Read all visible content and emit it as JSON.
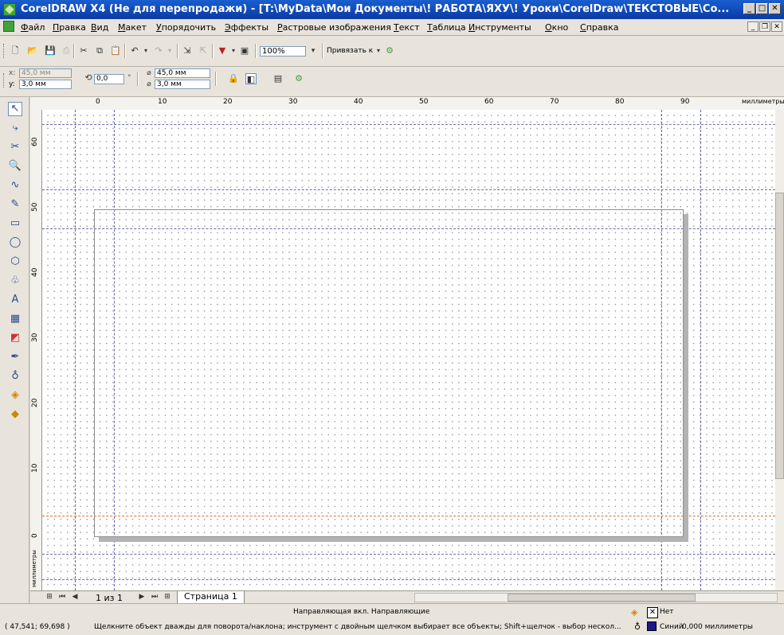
{
  "window": {
    "title": "CorelDRAW X4 (Не для перепродажи) - [T:\\MyData\\Мои Документы\\! РАБОТА\\ЯХУ\\! Уроки\\CorelDraw\\ТЕКСТОВЫЕ\\Со...",
    "app_icon": "coreldraw-app-icon",
    "controls": {
      "minimize": "_",
      "maximize": "□",
      "close": "✕"
    },
    "doc_controls": {
      "minimize": "_",
      "restore": "❐",
      "close": "✕"
    }
  },
  "menu": {
    "items": [
      "Файл",
      "Правка",
      "Вид",
      "Макет",
      "Упорядочить",
      "Эффекты",
      "Растровые изображения",
      "Текст",
      "Таблица",
      "Инструменты",
      "Окно",
      "Справка"
    ]
  },
  "standard_toolbar": {
    "zoom": "100%",
    "snap_label": "Привязать к"
  },
  "property_bar": {
    "x_label": "x:",
    "x_value": "45,0 мм",
    "y_label": "y:",
    "y_value": "3,0 мм",
    "rotation_value": "0,0",
    "degree_symbol": "°",
    "size_w": "45,0 мм",
    "size_h": "3,0 мм"
  },
  "ruler": {
    "unit": "миллиметры",
    "h_labels": [
      "0",
      "10",
      "20",
      "30",
      "40",
      "50",
      "60",
      "70",
      "80",
      "90"
    ],
    "v_labels": [
      "60",
      "50",
      "40",
      "30",
      "20",
      "10",
      "0"
    ],
    "v_unit": "миллиметры"
  },
  "toolbox": {
    "tools": [
      "pick-tool",
      "shape-tool",
      "crop-tool",
      "zoom-tool",
      "freehand-tool",
      "smart-fill-tool",
      "rectangle-tool",
      "ellipse-tool",
      "polygon-tool",
      "basic-shapes-tool",
      "text-tool",
      "table-tool",
      "interactive-blend-tool",
      "eyedropper-tool",
      "outline-tool",
      "fill-tool",
      "interactive-fill-tool"
    ]
  },
  "page_nav": {
    "page_count": "1 из 1",
    "page_tab": "Страница 1"
  },
  "status": {
    "center_text": "Направляющая вкл. Направляющие",
    "coords": "( 47,541; 69,698 )",
    "hint": "Щелкните объект дважды для поворота/наклона; инструмент с двойным щелчком выбирает все объекты; Shift+щелчок - выбор нескол...",
    "fill_label": "Нет",
    "outline_color_name": "Синий",
    "outline_width": "0,000 миллиметры",
    "outline_swatch_color": "#1a1a8c"
  }
}
